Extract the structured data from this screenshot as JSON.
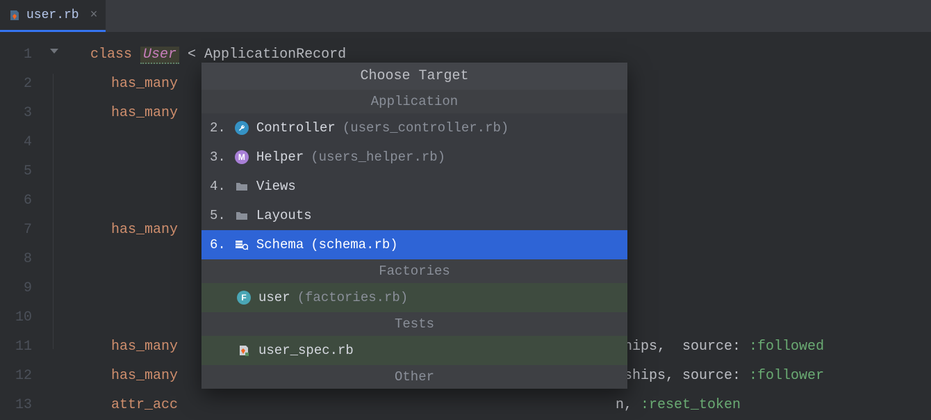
{
  "tab": {
    "filename": "user.rb"
  },
  "lines": [
    "1",
    "2",
    "3",
    "4",
    "5",
    "6",
    "7",
    "8",
    "9",
    "10",
    "11",
    "12",
    "13"
  ],
  "code": {
    "l1_class": "class",
    "l1_user": "User",
    "l1_rest": " < ApplicationRecord",
    "l2": "has_many",
    "l3": "has_many",
    "l7": "has_many",
    "l11_kw": "has_many",
    "l11_tail_a": "ships,  source: ",
    "l11_tail_b": ":followed",
    "l12_kw": "has_many",
    "l12_tail_a": "nships, source: ",
    "l12_tail_b": ":follower",
    "l13_kw": "attr_acc",
    "l13_tail_a": "n, ",
    "l13_tail_b": ":reset_token"
  },
  "popup": {
    "title": "Choose Target",
    "sections": {
      "application": "Application",
      "factories": "Factories",
      "tests": "Tests",
      "other": "Other"
    },
    "items": {
      "controller": {
        "num": "2.",
        "label": "Controller",
        "paren": "(users_controller.rb)",
        "badge": ""
      },
      "helper": {
        "num": "3.",
        "label": "Helper",
        "paren": "(users_helper.rb)",
        "badge": "M"
      },
      "views": {
        "num": "4.",
        "label": "Views"
      },
      "layouts": {
        "num": "5.",
        "label": "Layouts"
      },
      "schema": {
        "num": "6.",
        "label": "Schema",
        "paren": "(schema.rb)"
      },
      "user_factory": {
        "label": "user",
        "paren": "(factories.rb)",
        "badge": "F"
      },
      "user_spec": {
        "label": "user_spec.rb"
      }
    }
  }
}
